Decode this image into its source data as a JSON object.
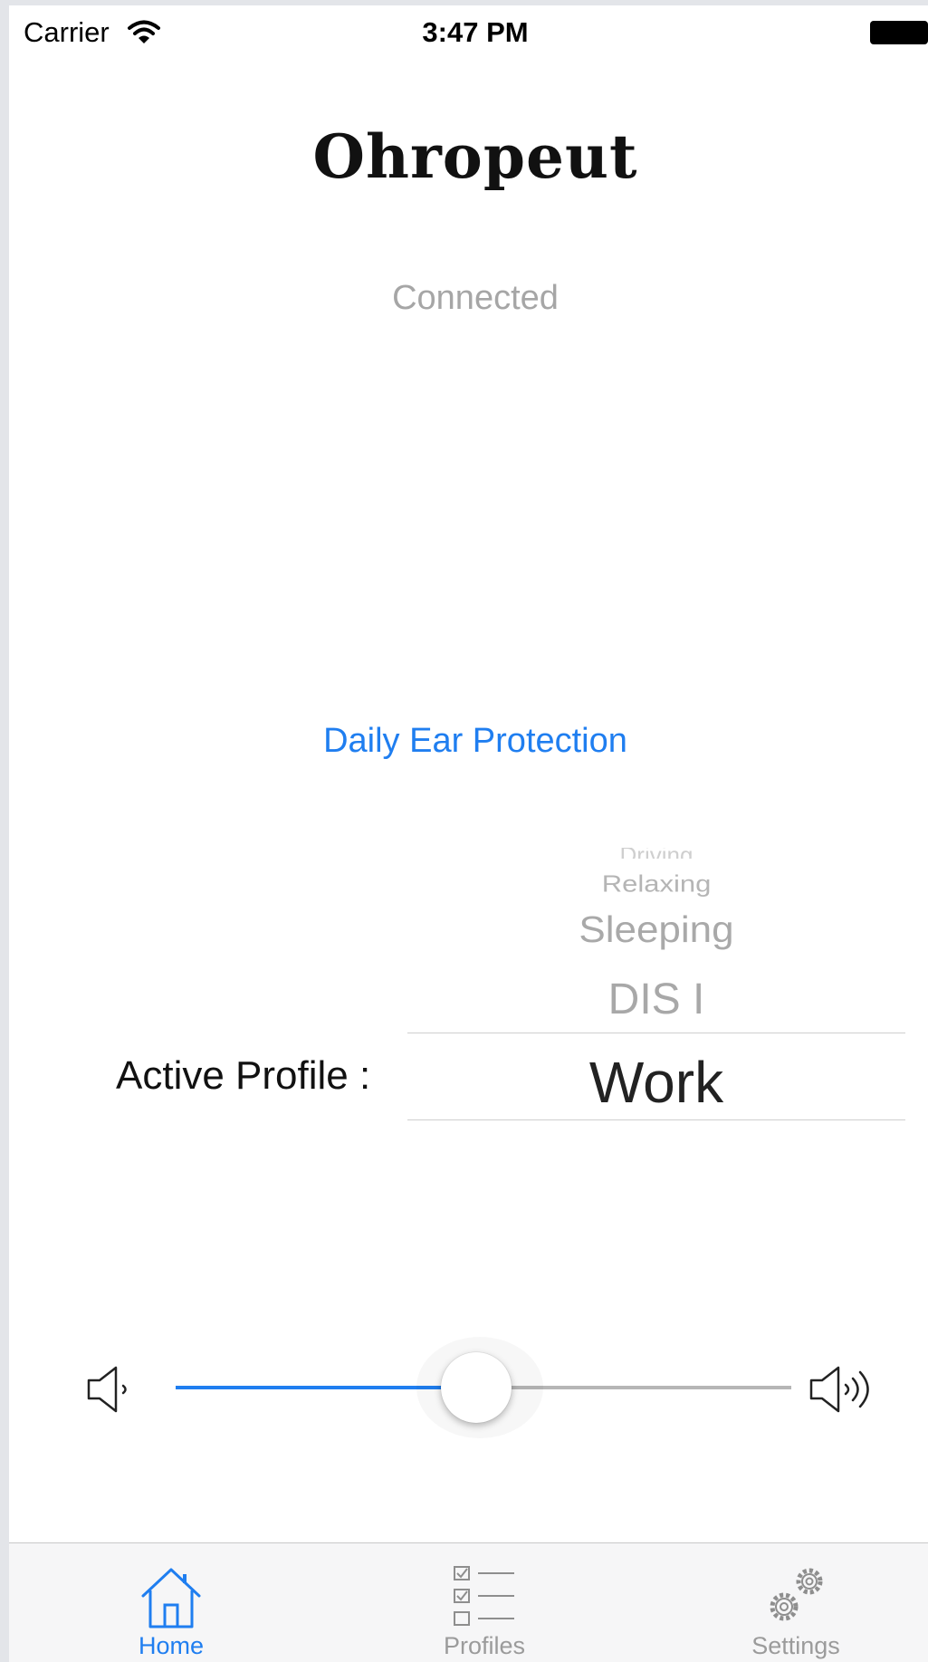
{
  "status_bar": {
    "carrier": "Carrier",
    "time": "3:47 PM"
  },
  "header": {
    "logo": "Ohropeut",
    "connection_status": "Connected"
  },
  "mode_link": "Daily Ear Protection",
  "profile": {
    "label": "Active Profile :",
    "options": [
      "Driving",
      "Relaxing",
      "Sleeping",
      "DIS I",
      "Work"
    ],
    "selected": "Work"
  },
  "volume": {
    "level_fraction": 0.5,
    "accent": "#1f7ef0"
  },
  "tabs": [
    {
      "label": "Home",
      "icon": "home-icon",
      "active": true
    },
    {
      "label": "Profiles",
      "icon": "checklist-icon",
      "active": false
    },
    {
      "label": "Settings",
      "icon": "gears-icon",
      "active": false
    }
  ]
}
